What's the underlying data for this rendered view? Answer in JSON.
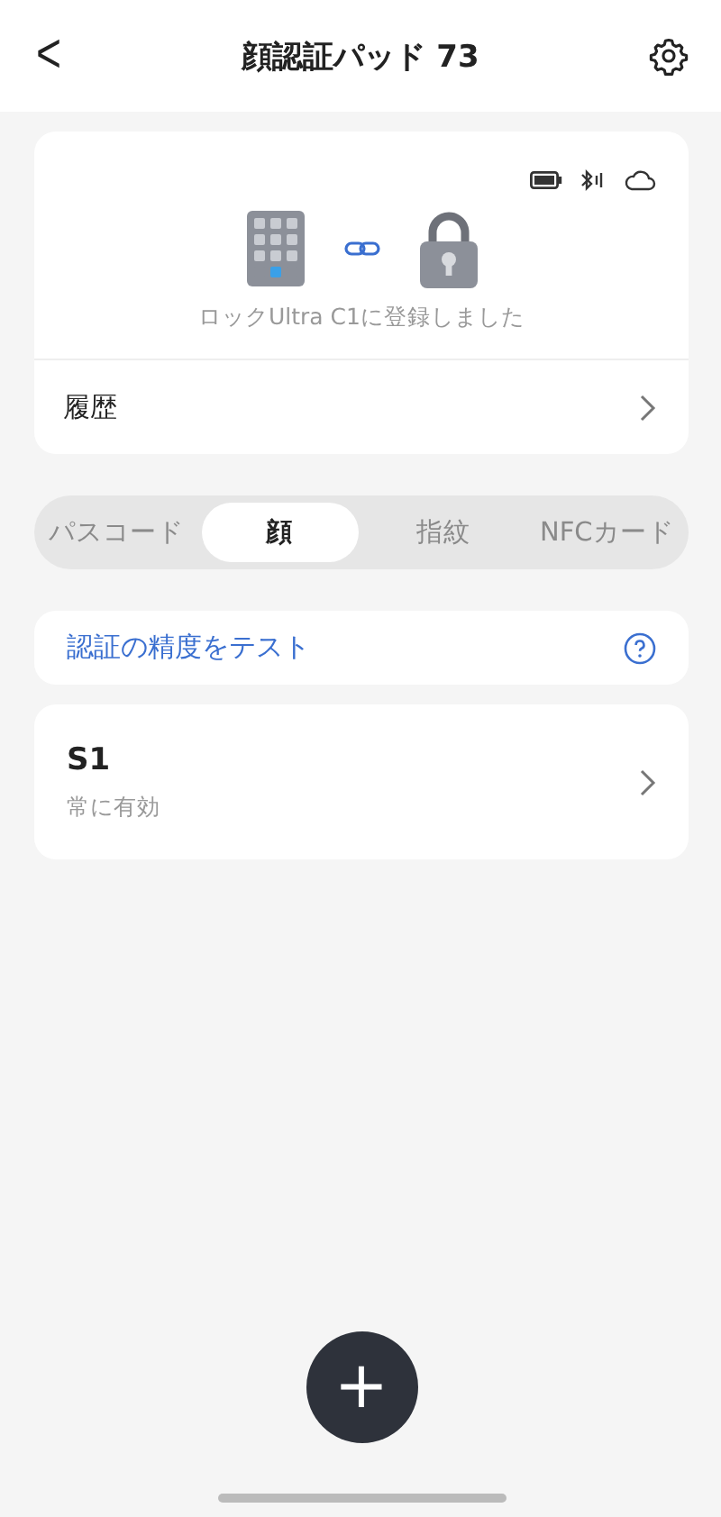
{
  "header": {
    "back": "<",
    "title": "顔認証パッド 73"
  },
  "device": {
    "status": "ロックUltra C1に登録しました",
    "history": "履歴"
  },
  "tabs": [
    {
      "label": "パスコード",
      "selected": false
    },
    {
      "label": "顔",
      "selected": true
    },
    {
      "label": "指紋",
      "selected": false
    },
    {
      "label": "NFCカード",
      "selected": false
    }
  ],
  "test": {
    "label": "認証の精度をテスト"
  },
  "entries": [
    {
      "name": "S1",
      "validity": "常に有効"
    }
  ],
  "fab": "+"
}
